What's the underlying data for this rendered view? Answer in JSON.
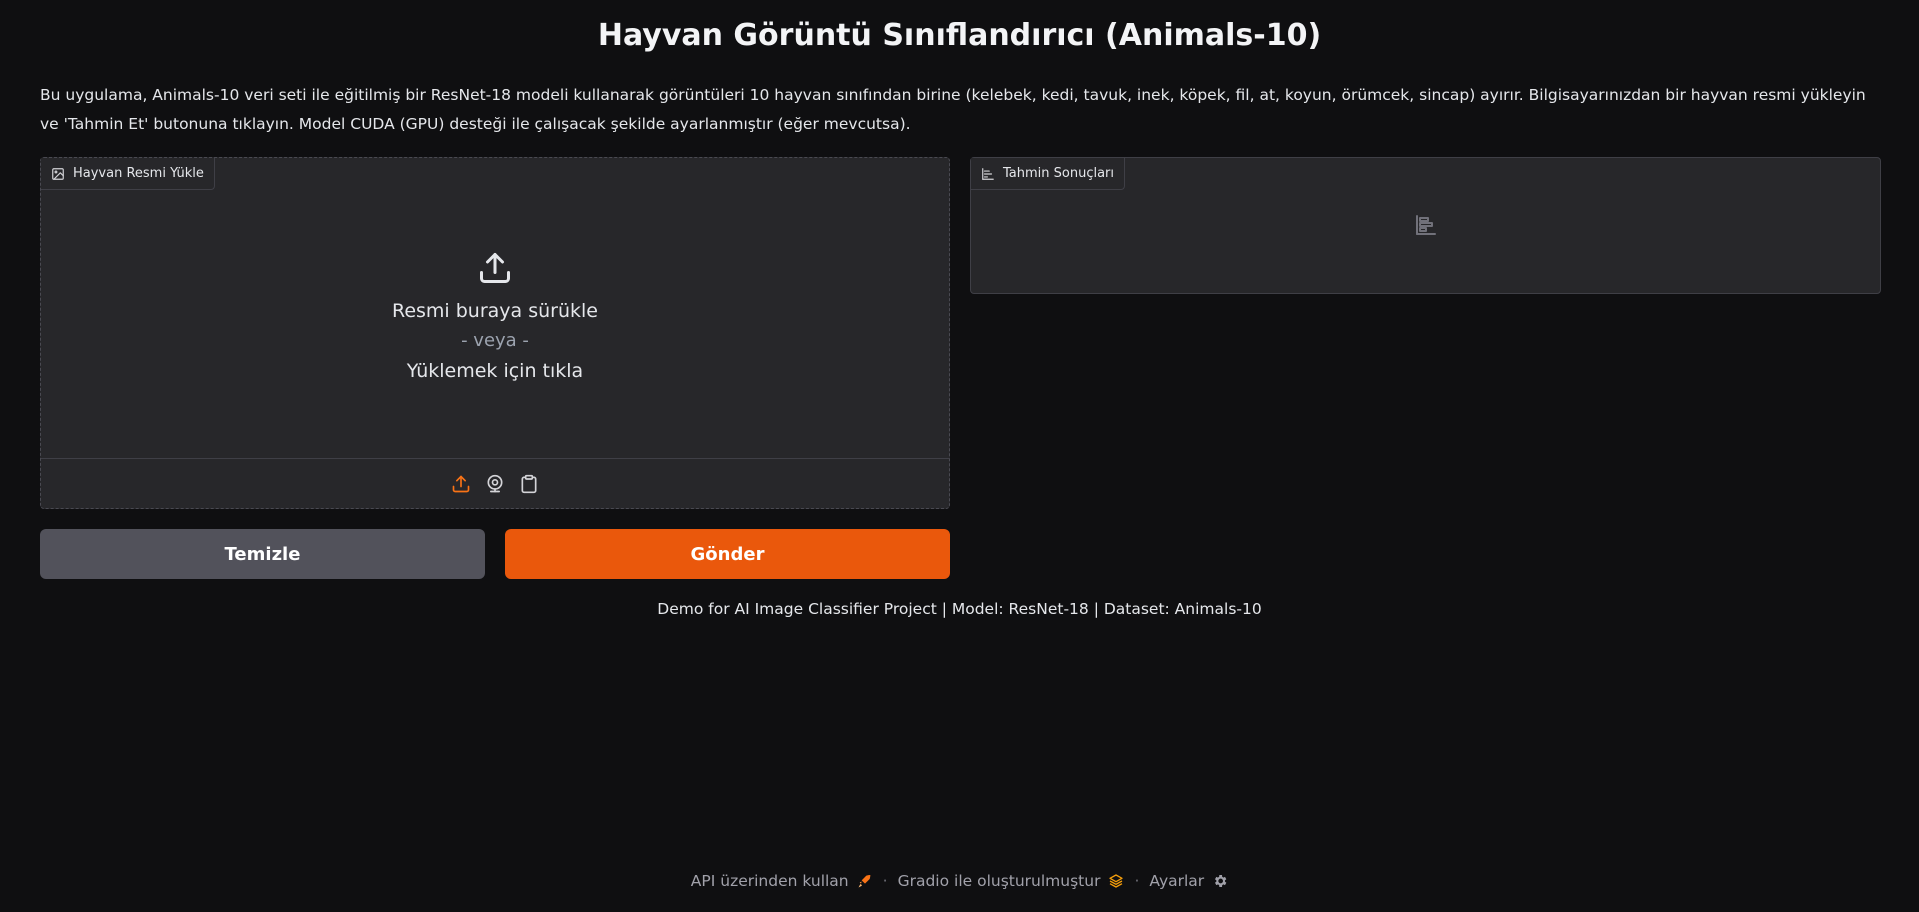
{
  "header": {
    "title": "Hayvan Görüntü Sınıflandırıcı (Animals-10)",
    "description": "Bu uygulama, Animals-10 veri seti ile eğitilmiş bir ResNet-18 modeli kullanarak görüntüleri 10 hayvan sınıfından birine (kelebek, kedi, tavuk, inek, köpek, fil, at, koyun, örümcek, sincap) ayırır. Bilgisayarınızdan bir hayvan resmi yükleyin ve 'Tahmin Et' butonuna tıklayın. Model CUDA (GPU) desteği ile çalışacak şekilde ayarlanmıştır (eğer mevcutsa)."
  },
  "upload": {
    "label": "Hayvan Resmi Yükle",
    "label_icon": "image-icon",
    "drop_text": "Resmi buraya sürükle",
    "or_text": "- veya -",
    "click_text": "Yüklemek için tıkla",
    "sources": [
      "upload-icon",
      "webcam-icon",
      "clipboard-icon"
    ]
  },
  "results": {
    "label": "Tahmin Sonuçları",
    "label_icon": "bar-chart-icon"
  },
  "buttons": {
    "clear": "Temizle",
    "submit": "Gönder"
  },
  "footnote": "Demo for AI Image Classifier Project | Model: ResNet-18 | Dataset: Animals-10",
  "footer": {
    "api": "API üzerinden kullan",
    "built_with": "Gradio ile oluşturulmuştur",
    "settings": "Ayarlar",
    "separator": "·"
  },
  "colors": {
    "background": "#0f0f11",
    "panel": "#27272a",
    "accent": "#ea580c",
    "secondary_button": "#52525b"
  }
}
